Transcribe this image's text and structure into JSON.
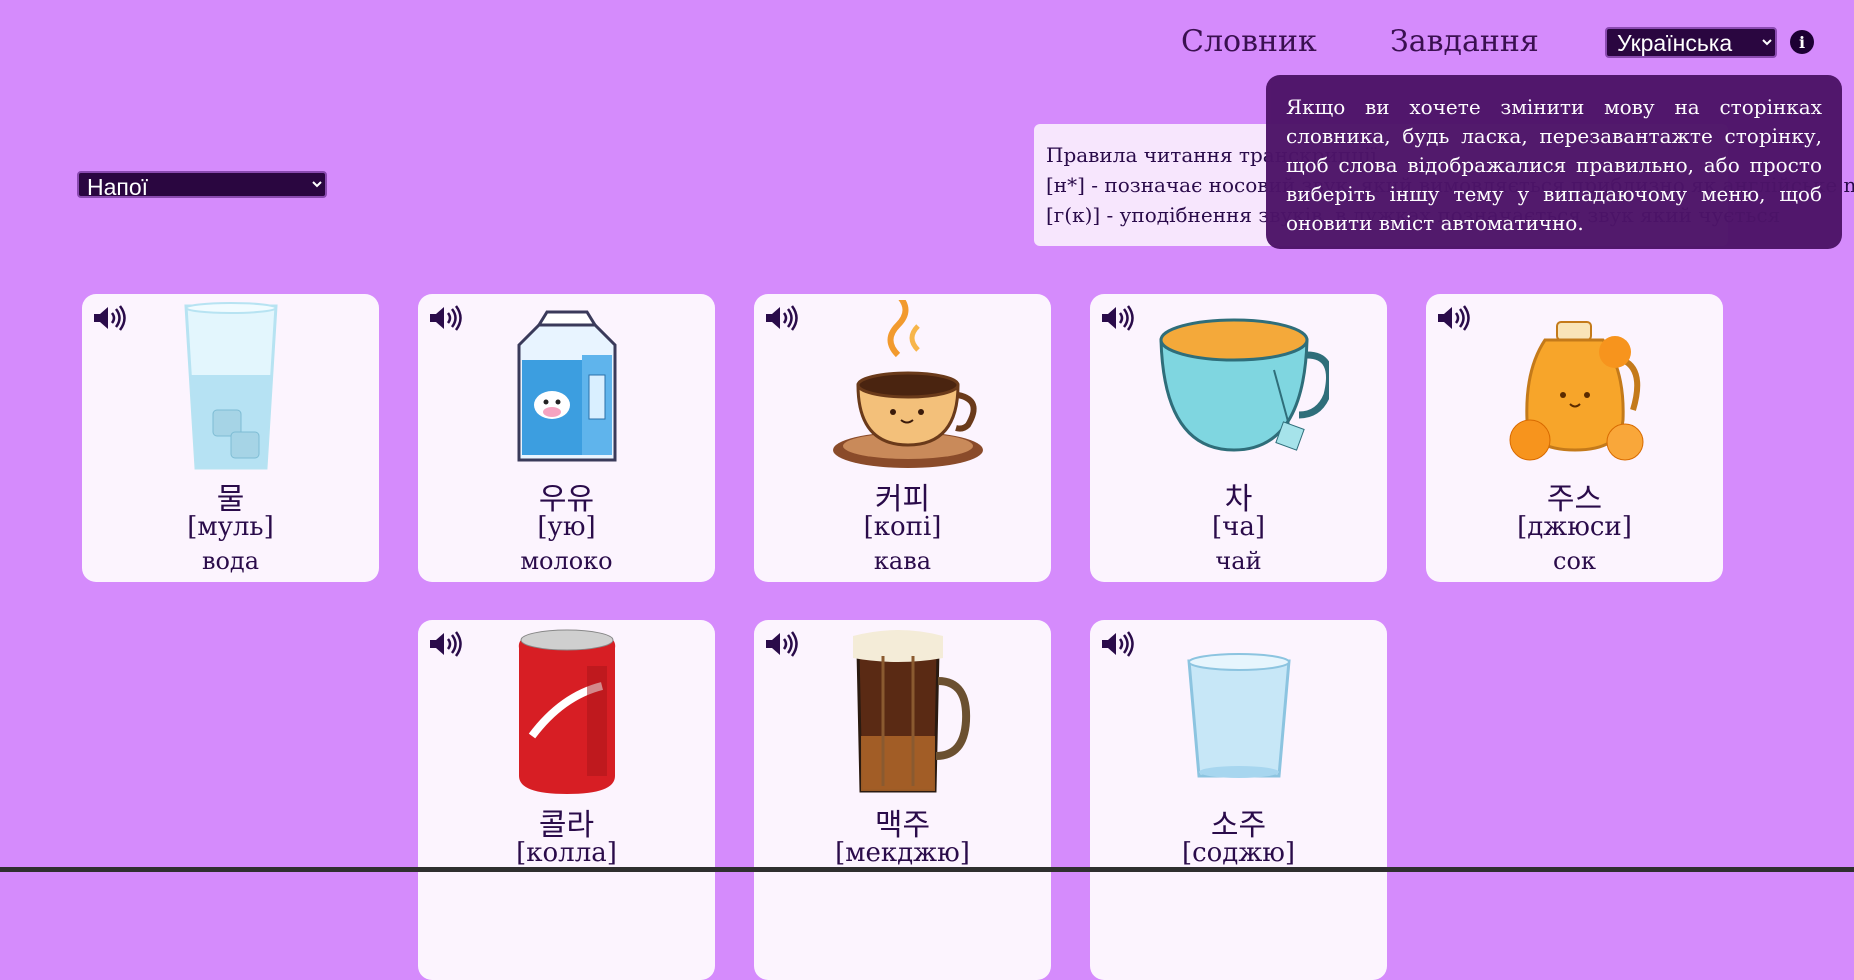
{
  "nav": {
    "dictionary": "Словник",
    "tasks": "Завдання",
    "language": "Українська",
    "info": "i"
  },
  "topic": {
    "selected": "Напої"
  },
  "rules": {
    "title": "Правила читання транскрипції",
    "line1": "[н*] - позначає носовий звук, який вимовляється приблизно як англійське ng",
    "line2": "[г(к)] - уподібнення звуків, в дужках позначається звук який чується"
  },
  "tooltip": {
    "text": "Якщо ви хочете змінити мову на сторінках словника, будь ласка, перезавантажте сторінку, щоб слова відображалися правильно, або просто виберіть іншу тему у випадаючому меню, щоб оновити вміст автоматично."
  },
  "cards": [
    {
      "korean": "물",
      "translit": "[муль]",
      "translation": "вода",
      "icon": "water-glass-icon"
    },
    {
      "korean": "우유",
      "translit": "[ую]",
      "translation": "молоко",
      "icon": "milk-carton-icon"
    },
    {
      "korean": "커피",
      "translit": "[копі]",
      "translation": "кава",
      "icon": "coffee-cup-icon"
    },
    {
      "korean": "차",
      "translit": "[ча]",
      "translation": "чай",
      "icon": "tea-cup-icon"
    },
    {
      "korean": "주스",
      "translit": "[джюси]",
      "translation": "сок",
      "icon": "juice-jug-icon"
    },
    {
      "korean": "콜라",
      "translit": "[колла]",
      "translation": "",
      "icon": "cola-can-icon"
    },
    {
      "korean": "맥주",
      "translit": "[мекджю]",
      "translation": "",
      "icon": "beer-mug-icon"
    },
    {
      "korean": "소주",
      "translit": "[соджю]",
      "translation": "",
      "icon": "soju-glass-icon"
    }
  ],
  "colors": {
    "background": "#d58bfc",
    "card": "#fcf4fe",
    "tooltip": "#4d1468",
    "select": "#2a0640",
    "text": "#2a0b4a"
  }
}
